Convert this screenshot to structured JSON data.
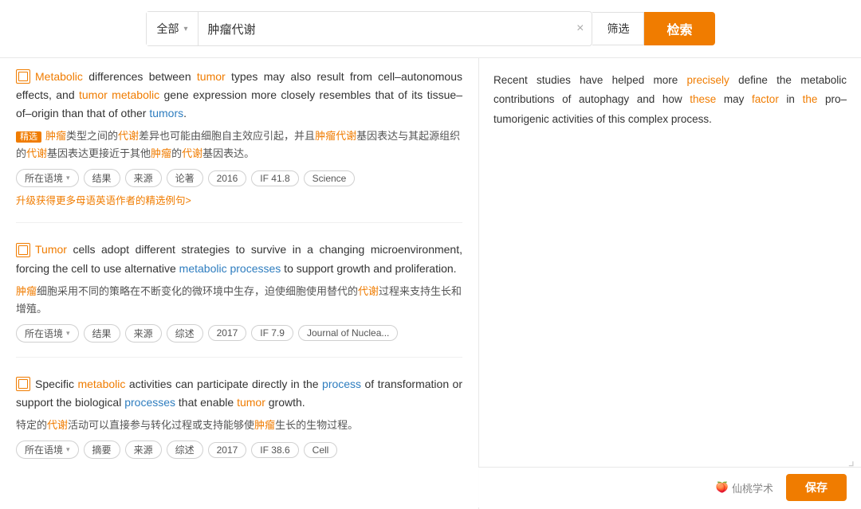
{
  "searchBar": {
    "category": "全部",
    "query": "肿瘤代谢",
    "clearLabel": "×",
    "filterLabel": "筛选",
    "searchLabel": "检索"
  },
  "results": [
    {
      "id": 1,
      "en_parts": [
        {
          "text": "Metabolic",
          "type": "orange"
        },
        {
          "text": " differences between ",
          "type": "plain"
        },
        {
          "text": "tumor",
          "type": "orange"
        },
        {
          "text": " types may also result from cell–autonomous effects, and ",
          "type": "plain"
        },
        {
          "text": "tumor metabolic",
          "type": "orange"
        },
        {
          "text": " gene expression more closely resembles that of its tissue–of–origin than that of other ",
          "type": "plain"
        },
        {
          "text": "tumors",
          "type": "blue"
        },
        {
          "text": ".",
          "type": "plain"
        }
      ],
      "cn_label": "精选",
      "cn_parts": [
        {
          "text": "肿瘤",
          "type": "orange"
        },
        {
          "text": "类型之间的",
          "type": "plain"
        },
        {
          "text": "代谢",
          "type": "orange"
        },
        {
          "text": "差异也可能由细胞自主效应引起，并且",
          "type": "plain"
        },
        {
          "text": "肿瘤代谢",
          "type": "orange"
        },
        {
          "text": "基因表达与其起源组织的",
          "type": "plain"
        },
        {
          "text": "代谢",
          "type": "orange"
        },
        {
          "text": "基因表达更接近于其他",
          "type": "plain"
        },
        {
          "text": "肿瘤",
          "type": "orange"
        },
        {
          "text": "的",
          "type": "plain"
        },
        {
          "text": "代谢",
          "type": "orange"
        },
        {
          "text": "基因表达。",
          "type": "plain"
        }
      ],
      "tags": [
        {
          "label": "所在语境",
          "hasChevron": true,
          "type": "context"
        },
        {
          "label": "结果",
          "hasChevron": false,
          "type": "result"
        },
        {
          "label": "来源",
          "hasChevron": false,
          "type": "source"
        },
        {
          "label": "论著",
          "hasChevron": false,
          "type": "type"
        },
        {
          "label": "2016",
          "hasChevron": false,
          "type": "year"
        },
        {
          "label": "IF 41.8",
          "hasChevron": false,
          "type": "if"
        },
        {
          "label": "Science",
          "hasChevron": false,
          "type": "journal"
        }
      ],
      "upgradeLink": "升级获得更多母语英语作者的精选例句>"
    },
    {
      "id": 2,
      "en_parts": [
        {
          "text": "Tumor",
          "type": "orange"
        },
        {
          "text": " cells adopt different strategies to survive in a changing microenvironment, forcing the cell to use alternative ",
          "type": "plain"
        },
        {
          "text": "metabolic processes",
          "type": "blue"
        },
        {
          "text": " to support growth and proliferation.",
          "type": "plain"
        }
      ],
      "cn_parts": [
        {
          "text": "肿瘤",
          "type": "orange"
        },
        {
          "text": "细胞采用不同的策略在不断变化的微环境中生存，迫使细胞使用替代的",
          "type": "plain"
        },
        {
          "text": "代谢",
          "type": "orange"
        },
        {
          "text": "过程来支持生长和增殖。",
          "type": "plain"
        }
      ],
      "tags": [
        {
          "label": "所在语境",
          "hasChevron": true,
          "type": "context"
        },
        {
          "label": "结果",
          "hasChevron": false,
          "type": "result"
        },
        {
          "label": "来源",
          "hasChevron": false,
          "type": "source"
        },
        {
          "label": "综述",
          "hasChevron": false,
          "type": "type"
        },
        {
          "label": "2017",
          "hasChevron": false,
          "type": "year"
        },
        {
          "label": "IF 7.9",
          "hasChevron": false,
          "type": "if"
        },
        {
          "label": "Journal of Nuclea...",
          "hasChevron": false,
          "type": "journal"
        }
      ]
    },
    {
      "id": 3,
      "en_parts": [
        {
          "text": "Specific ",
          "type": "plain"
        },
        {
          "text": "metabolic",
          "type": "orange"
        },
        {
          "text": " activities can participate directly in the ",
          "type": "plain"
        },
        {
          "text": "process",
          "type": "blue"
        },
        {
          "text": " of transformation or support the biological ",
          "type": "plain"
        },
        {
          "text": "processes",
          "type": "blue"
        },
        {
          "text": " that enable ",
          "type": "plain"
        },
        {
          "text": "tumor",
          "type": "orange"
        },
        {
          "text": " growth.",
          "type": "plain"
        }
      ],
      "cn_parts": [
        {
          "text": "特定的",
          "type": "plain"
        },
        {
          "text": "代谢",
          "type": "orange"
        },
        {
          "text": "活动可以直接参与转化过程或支持能够使",
          "type": "plain"
        },
        {
          "text": "肿瘤",
          "type": "orange"
        },
        {
          "text": "生长的生物过程。",
          "type": "plain"
        }
      ],
      "tags": [
        {
          "label": "所在语境",
          "hasChevron": true,
          "type": "context"
        },
        {
          "label": "摘要",
          "hasChevron": false,
          "type": "abstract"
        },
        {
          "label": "来源",
          "hasChevron": false,
          "type": "source"
        },
        {
          "label": "综述",
          "hasChevron": false,
          "type": "type"
        },
        {
          "label": "2017",
          "hasChevron": false,
          "type": "year"
        },
        {
          "label": "IF 38.6",
          "hasChevron": false,
          "type": "if"
        },
        {
          "label": "Cell",
          "hasChevron": false,
          "type": "journal"
        }
      ]
    }
  ],
  "preview": {
    "text": "Recent studies have helped more precisely define the metabolic contributions of autophagy and how these may factor in the pro–tumorigenic activities of this complex process."
  },
  "watermark": {
    "icon": "🍑",
    "label": "仙桃学术"
  },
  "saveButton": {
    "label": "保存"
  }
}
